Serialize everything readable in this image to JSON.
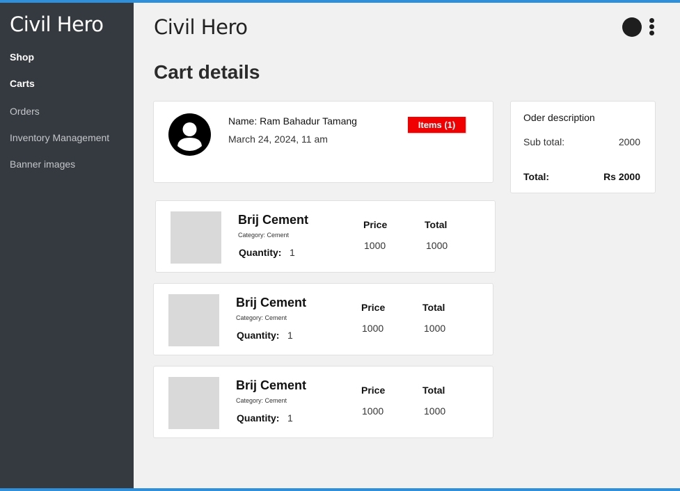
{
  "app": {
    "title": "Civil Hero"
  },
  "sidebar": {
    "items": [
      {
        "label": "Shop"
      },
      {
        "label": "Carts"
      },
      {
        "label": "Orders"
      },
      {
        "label": "Inventory Management"
      },
      {
        "label": "Banner images"
      }
    ]
  },
  "header": {
    "title": "Civil Hero"
  },
  "page": {
    "title": "Cart details"
  },
  "customer": {
    "name": "Name: Ram Bahadur Tamang",
    "date": "March 24, 2024, 11 am",
    "items_badge": "Items (1)"
  },
  "order_description": {
    "title": "Oder description",
    "subtotal_label": "Sub total:",
    "subtotal_value": "2000",
    "total_label": "Total:",
    "total_value": "Rs 2000"
  },
  "products": [
    {
      "name": "Brij Cement",
      "category": "Category: Cement",
      "quantity_label": "Quantity:",
      "quantity": "1",
      "price_label": "Price",
      "price": "1000",
      "total_label": "Total",
      "total": "1000"
    },
    {
      "name": "Brij Cement",
      "category": "Category: Cement",
      "quantity_label": "Quantity:",
      "quantity": "1",
      "price_label": "Price",
      "price": "1000",
      "total_label": "Total",
      "total": "1000"
    },
    {
      "name": "Brij Cement",
      "category": "Category: Cement",
      "quantity_label": "Quantity:",
      "quantity": "1",
      "price_label": "Price",
      "price": "1000",
      "total_label": "Total",
      "total": "1000"
    }
  ],
  "colors": {
    "sidebar_bg": "#353a40",
    "page_bg": "#f1f1f1",
    "badge": "#f00000",
    "frame_accent": "#2f8fd8"
  }
}
